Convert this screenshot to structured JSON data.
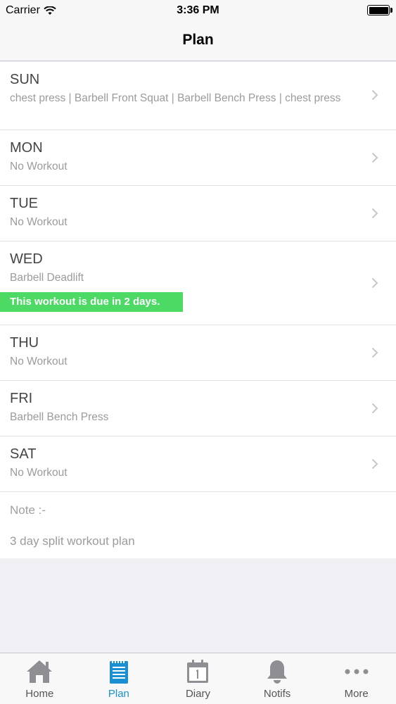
{
  "status_bar": {
    "carrier": "Carrier",
    "time": "3:36 PM",
    "battery_level": 1.0
  },
  "nav": {
    "title": "Plan"
  },
  "days": [
    {
      "day": "SUN",
      "workouts": "chest press | Barbell Front Squat | Barbell Bench Press | chest press"
    },
    {
      "day": "MON",
      "workouts": "No Workout"
    },
    {
      "day": "TUE",
      "workouts": "No Workout"
    },
    {
      "day": "WED",
      "workouts": "Barbell Deadlift",
      "due_banner": "This workout is due in 2 days."
    },
    {
      "day": "THU",
      "workouts": "No Workout"
    },
    {
      "day": "FRI",
      "workouts": "Barbell Bench Press"
    },
    {
      "day": "SAT",
      "workouts": "No Workout"
    }
  ],
  "notes": {
    "label": "Note :-",
    "text": "3 day split workout plan"
  },
  "tabs": [
    {
      "label": "Home",
      "icon": "home-icon",
      "active": false
    },
    {
      "label": "Plan",
      "icon": "notepad-icon",
      "active": true
    },
    {
      "label": "Diary",
      "icon": "calendar-icon",
      "active": false
    },
    {
      "label": "Notifs",
      "icon": "bell-icon",
      "active": false
    },
    {
      "label": "More",
      "icon": "more-dots-icon",
      "active": false
    }
  ],
  "colors": {
    "accent": "#1a8fd1",
    "due_banner": "#4cd964",
    "icon_gray": "#8e8e93"
  }
}
